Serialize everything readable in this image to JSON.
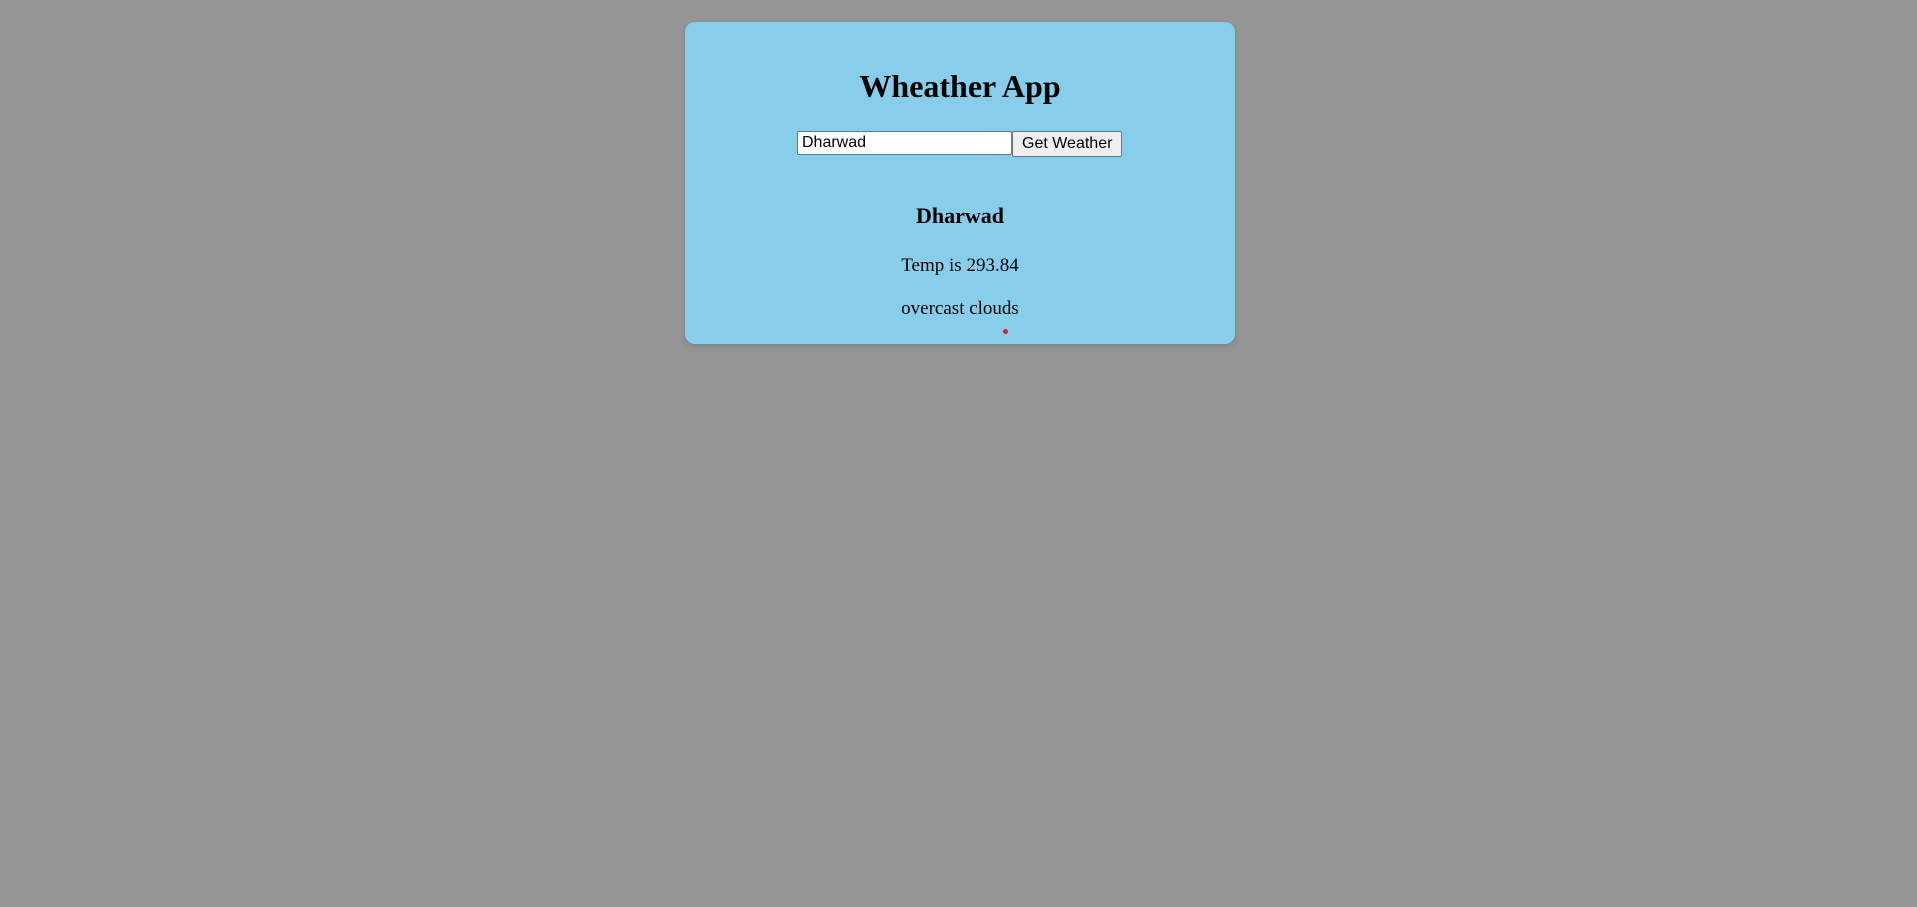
{
  "app": {
    "title": "Wheather App"
  },
  "search": {
    "value": "Dharwad",
    "button_label": "Get Weather"
  },
  "result": {
    "city": "Dharwad",
    "temp_prefix": "Temp is",
    "temp_value": "293.84",
    "description": "overcast clouds",
    "icon": "weather-icon"
  },
  "colors": {
    "page_background": "#959595",
    "card_background": "#87ceeb",
    "icon_dot": "#e0201c"
  }
}
